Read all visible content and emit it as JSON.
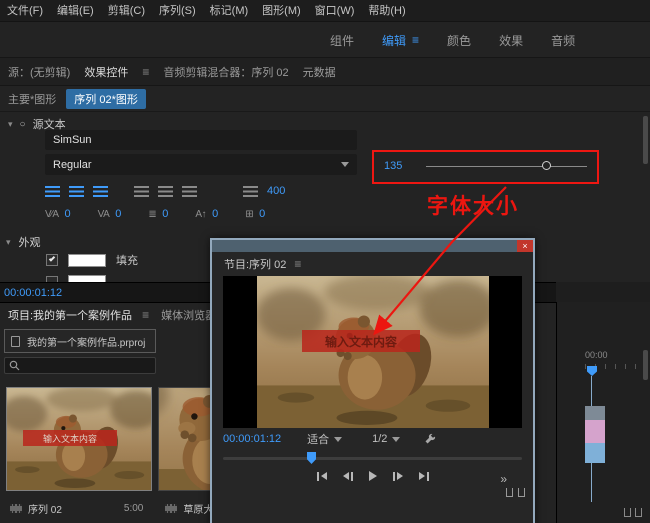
{
  "colors": {
    "accent": "#3f9bfa",
    "annotation_red": "#ee1712",
    "graphic_clip_pink": "#d5a3cc",
    "video_clip_blue": "#7fb0d8"
  },
  "icons": {
    "hamburger": "≡",
    "disclosure": "▾",
    "toggle_ring": "○",
    "kerning": "V∕A",
    "tracking": "VA",
    "leading": "≣",
    "baseline_shift": "A↑",
    "proportional_spacing": "⊞",
    "more": "»",
    "close": "×"
  },
  "menu_bar": {
    "items": [
      "文件(F)",
      "编辑(E)",
      "剪辑(C)",
      "序列(S)",
      "标记(M)",
      "图形(M)",
      "窗口(W)",
      "帮助(H)"
    ]
  },
  "workspace_bar": {
    "tabs": [
      {
        "label": "组件"
      },
      {
        "label": "编辑"
      },
      {
        "label": "颜色"
      },
      {
        "label": "效果"
      },
      {
        "label": "音频"
      }
    ],
    "active": "编辑"
  },
  "panel_tabs": {
    "source": "源：(无剪辑)",
    "effect_controls": "效果控件",
    "audio_mixer": "音频剪辑混合器：序列 02",
    "metadata": "元数据"
  },
  "clip_selector": {
    "master": "主要*图形",
    "sequence": "序列 02*图形"
  },
  "effect_controls": {
    "source_text": {
      "label": "源文本"
    },
    "font": {
      "family": "SimSun",
      "style": "Regular",
      "size": "135"
    },
    "alignment": {
      "value": "400"
    },
    "spacing": [
      {
        "name": "kerning",
        "value": "0"
      },
      {
        "name": "tracking",
        "value": "0"
      },
      {
        "name": "leading",
        "value": "0"
      },
      {
        "name": "baseline-shift",
        "value": "0"
      },
      {
        "name": "proportional-spacing",
        "value": "0"
      }
    ],
    "appearance": {
      "label": "外观",
      "fill_label": "填充"
    },
    "timecode": "00:00:01:12"
  },
  "annotation": {
    "label": "字体大小"
  },
  "project_panel": {
    "tabs": {
      "project": "项目:我的第一个案例作品",
      "media_browser": "媒体浏览器"
    },
    "project_file": "我的第一个案例作品.prproj",
    "items": [
      {
        "name": "序列 02",
        "duration": "5:00",
        "overlay_text": "输入文本内容"
      },
      {
        "name": "草原大"
      }
    ]
  },
  "timeline_panel": {
    "ruler_start": "00:00"
  },
  "program_monitor": {
    "tab": "节目:序列 02",
    "overlay_text": "输入文本内容",
    "timecode": "00:00:01:12",
    "fit": "适合",
    "playback_resolution": "1/2"
  }
}
